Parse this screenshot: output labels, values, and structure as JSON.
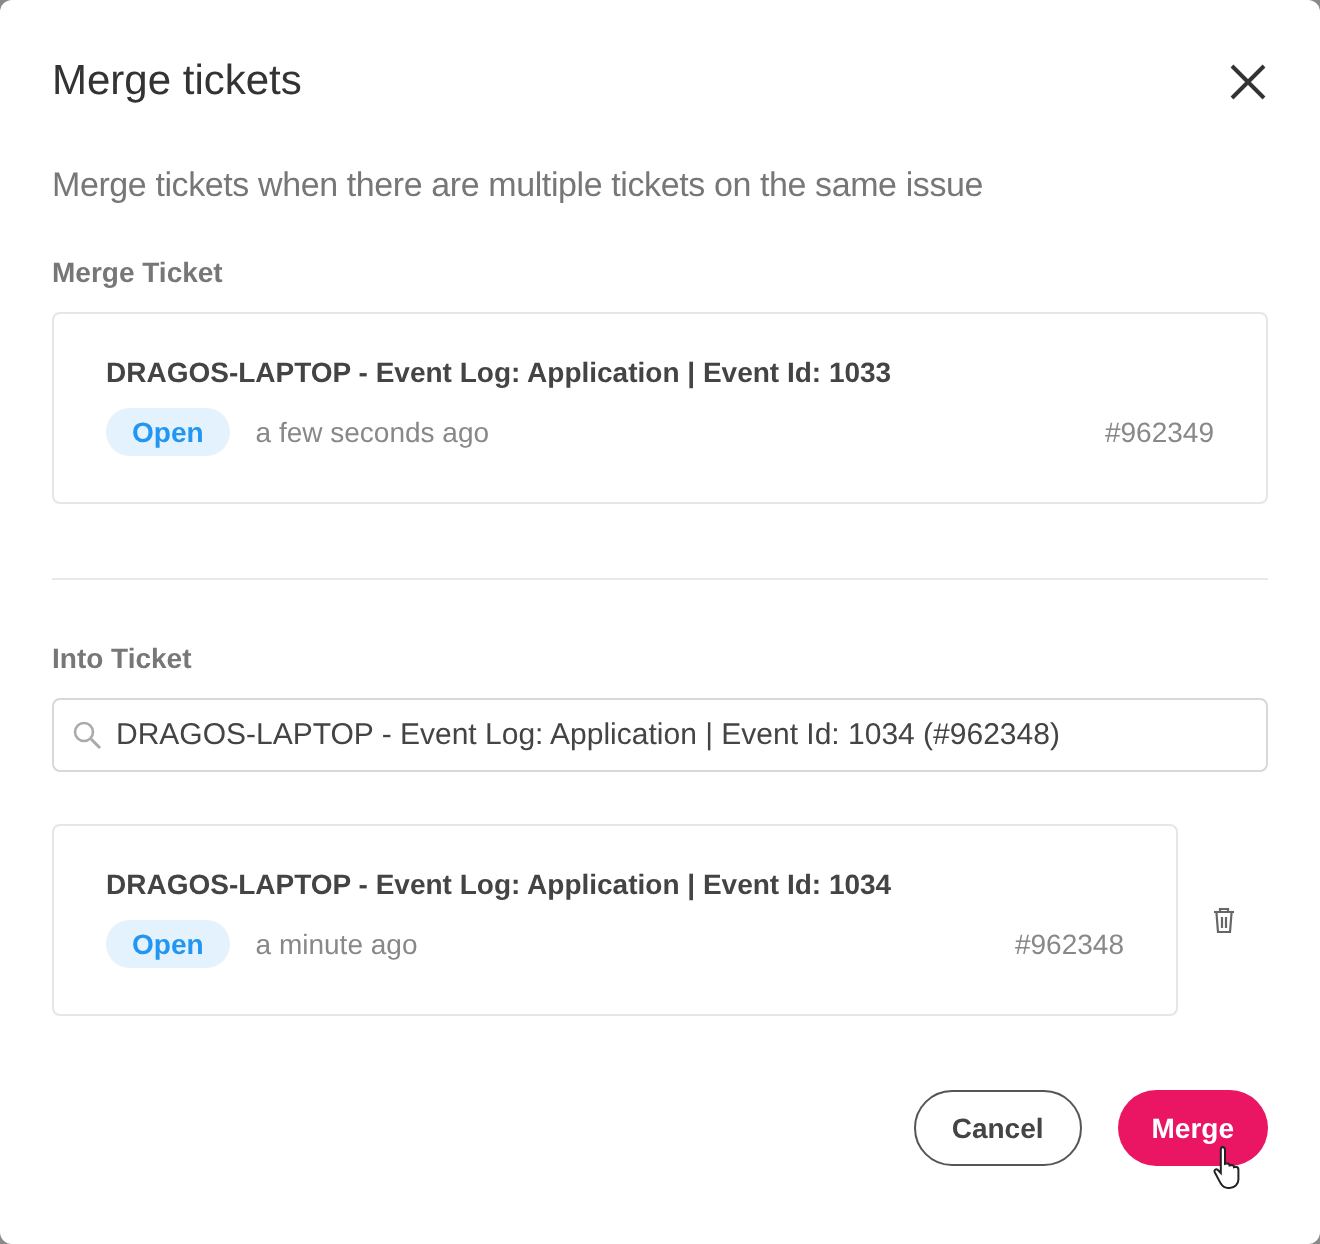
{
  "dialog": {
    "title": "Merge tickets",
    "description": "Merge tickets when there are multiple tickets on the same issue"
  },
  "merge_ticket": {
    "label": "Merge Ticket",
    "ticket": {
      "title": "DRAGOS-LAPTOP - Event Log: Application | Event Id: 1033",
      "status": {
        "label": "Open",
        "kind": "open"
      },
      "time": "a few seconds ago",
      "number": "#962349"
    }
  },
  "into_ticket": {
    "label": "Into Ticket",
    "search": {
      "value": "DRAGOS-LAPTOP - Event Log: Application | Event Id: 1034 (#962348)"
    },
    "ticket": {
      "title": "DRAGOS-LAPTOP - Event Log: Application | Event Id: 1034",
      "status": {
        "label": "Open",
        "kind": "open"
      },
      "time": "a minute ago",
      "number": "#962348"
    }
  },
  "buttons": [
    {
      "label": "Cancel",
      "kind": "secondary"
    },
    {
      "label": "Merge",
      "kind": "primary"
    }
  ]
}
